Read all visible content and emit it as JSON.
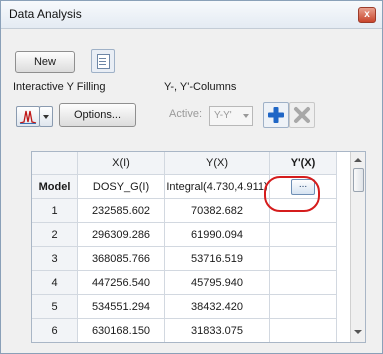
{
  "window": {
    "title": "Data Analysis",
    "close_glyph": "x"
  },
  "toolbar": {
    "new_label": "New"
  },
  "interactive_y_filling": {
    "label": "Interactive Y Filling",
    "options_label": "Options..."
  },
  "y_columns": {
    "label": "Y-, Y'-Columns",
    "active_label": "Active:",
    "active_value": "Y-Y'"
  },
  "grid": {
    "headers": [
      "X(I)",
      "Y(X)",
      "Y'(X)"
    ],
    "model_label": "Model",
    "model_row": [
      "DOSY_G(I)",
      "Integral(4.730,4.911)",
      "..."
    ],
    "rows": [
      {
        "n": "1",
        "x": "232585.602",
        "y": "70382.682"
      },
      {
        "n": "2",
        "x": "296309.286",
        "y": "61990.094"
      },
      {
        "n": "3",
        "x": "368085.766",
        "y": "53716.519"
      },
      {
        "n": "4",
        "x": "447256.540",
        "y": "45795.940"
      },
      {
        "n": "5",
        "x": "534551.294",
        "y": "38432.420"
      },
      {
        "n": "6",
        "x": "630168.150",
        "y": "31833.075"
      }
    ]
  },
  "icons": [
    "worksheet-icon",
    "peak-icon",
    "chevron-down-icon",
    "plus-icon",
    "delete-icon"
  ],
  "colors": {
    "highlight": "#d51c1c",
    "plus": "#1f66c6"
  }
}
